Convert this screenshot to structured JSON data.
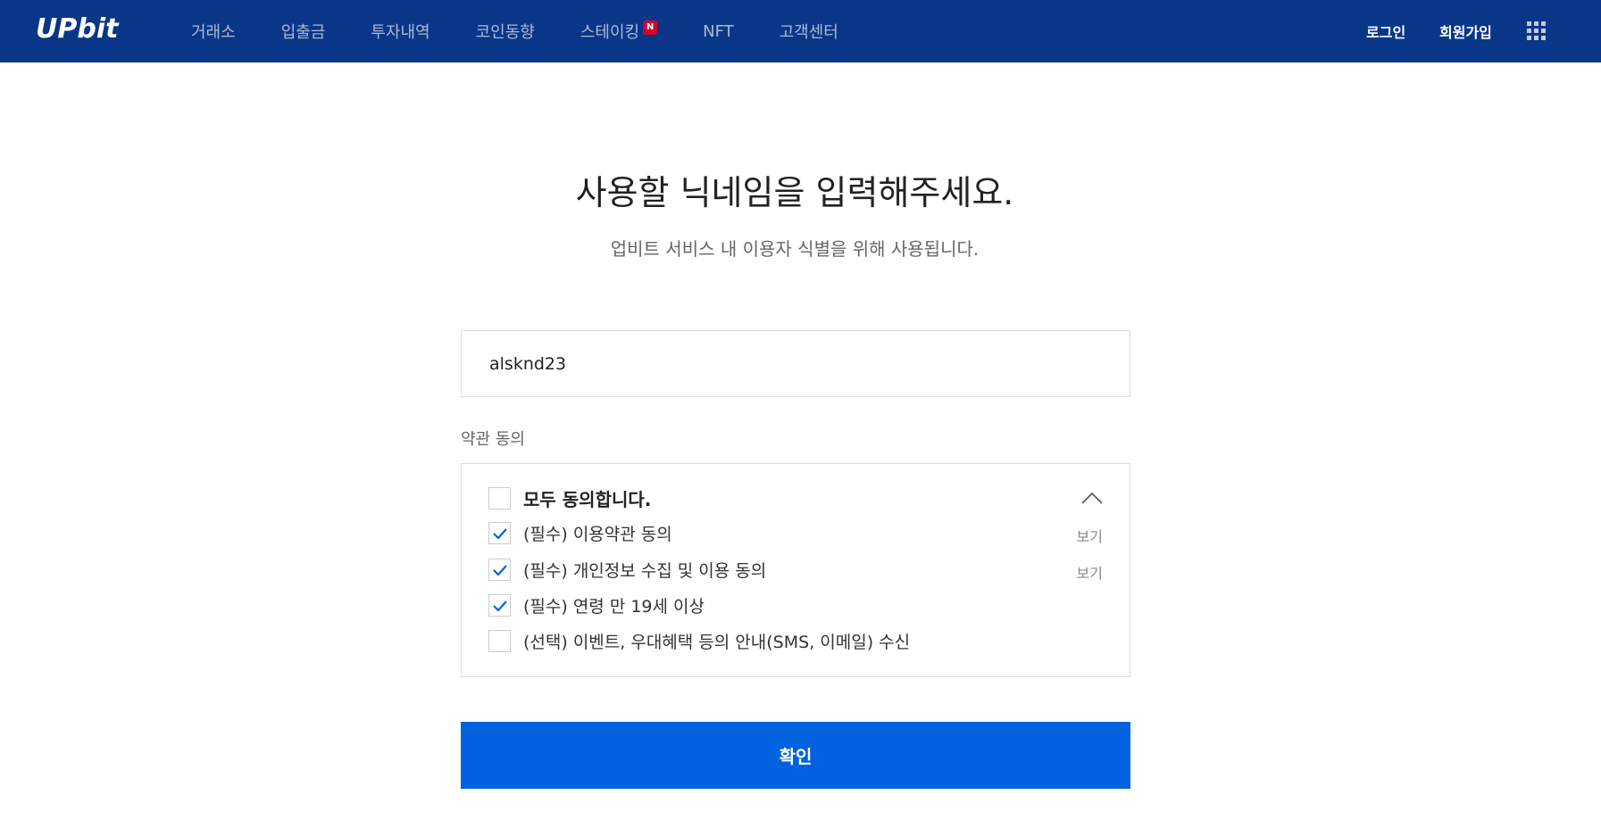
{
  "header": {
    "logo": "UPbit",
    "nav": [
      {
        "label": "거래소"
      },
      {
        "label": "입출금"
      },
      {
        "label": "투자내역"
      },
      {
        "label": "코인동향"
      },
      {
        "label": "스테이킹",
        "badge": "N"
      },
      {
        "label": "NFT"
      },
      {
        "label": "고객센터"
      }
    ],
    "login": "로그인",
    "signup": "회원가입"
  },
  "page": {
    "title": "사용할 닉네임을 입력해주세요.",
    "subtitle": "업비트 서비스 내 이용자 식별을 위해 사용됩니다.",
    "nickname_value": "alsknd23",
    "terms_label": "약관 동의",
    "agree_all": "모두 동의합니다.",
    "terms": [
      {
        "label": "(필수) 이용약관 동의",
        "checked": true,
        "view": "보기"
      },
      {
        "label": "(필수) 개인정보 수집 및 이용 동의",
        "checked": true,
        "view": "보기"
      },
      {
        "label": "(필수) 연령 만 19세 이상",
        "checked": true
      },
      {
        "label": "(선택) 이벤트, 우대혜택 등의 안내(SMS, 이메일) 수신",
        "checked": false
      }
    ],
    "confirm_label": "확인"
  },
  "colors": {
    "header_bg": "#093687",
    "primary_button": "#0062df",
    "check_color": "#0062df"
  }
}
